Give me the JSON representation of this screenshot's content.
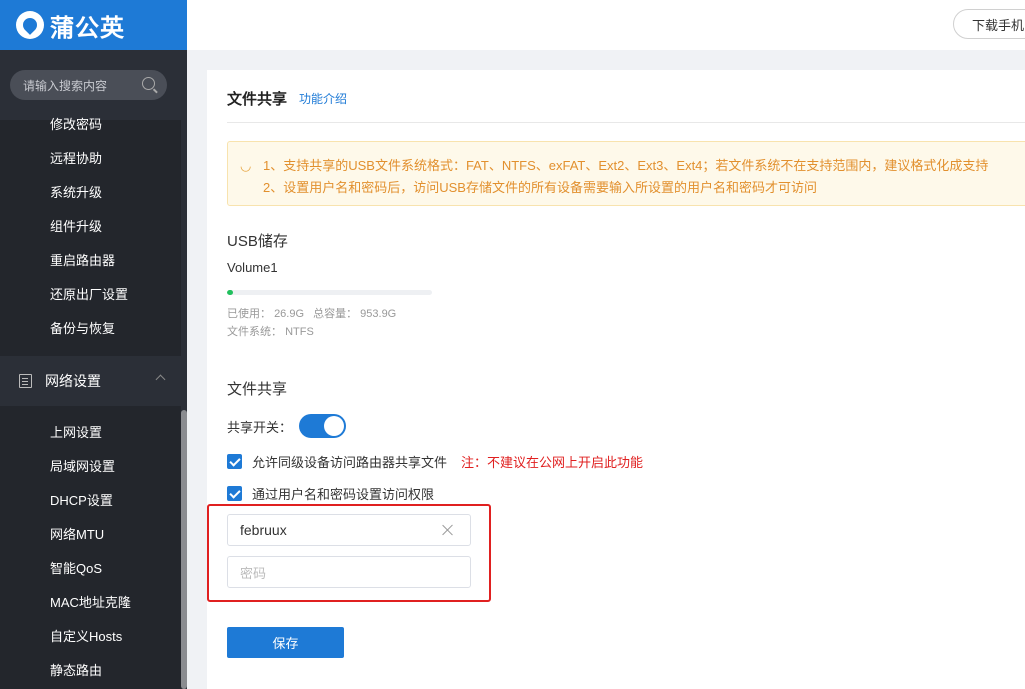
{
  "header": {
    "brand_name": "蒲公英",
    "download_label": "下载手机"
  },
  "sidebar": {
    "search_placeholder": "请输入搜索内容",
    "items_top": [
      "修改密码",
      "远程协助",
      "系统升级",
      "组件升级",
      "重启路由器",
      "还原出厂设置",
      "备份与恢复"
    ],
    "section": "网络设置",
    "items_network": [
      "上网设置",
      "局域网设置",
      "DHCP设置",
      "网络MTU",
      "智能QoS",
      "MAC地址克隆",
      "自定义Hosts",
      "静态路由"
    ]
  },
  "main": {
    "title": "文件共享",
    "intro_link": "功能介绍",
    "notice": [
      "1、支持共享的USB文件系统格式：FAT、NTFS、exFAT、Ext2、Ext3、Ext4；若文件系统不在支持范围内，建议格式化成支持",
      "2、设置用户名和密码后，访问USB存储文件的所有设备需要输入所设置的用户名和密码才可访问"
    ],
    "usb_title": "USB储存",
    "volume_name": "Volume1",
    "usage_fraction": 0.028,
    "used_label": "已使用：",
    "used_value": "26.9G",
    "total_label": "总容量：",
    "total_value": "953.9G",
    "fs_label": "文件系统：",
    "fs_value": "NTFS",
    "share_title": "文件共享",
    "switch_label": "共享开关：",
    "switch_on": true,
    "check1_label": "允许同级设备访问路由器共享文件",
    "check1_note": "注：不建议在公网上开启此功能",
    "check2_label": "通过用户名和密码设置访问权限",
    "username_value": "februux",
    "password_placeholder": "密码",
    "save_label": "保存"
  },
  "colors": {
    "brand": "#1e7ad6",
    "sidebar_bg": "#2b2f37",
    "warning": "#e02020",
    "notice_text": "#e2902e",
    "usage_green": "#21c05d"
  }
}
